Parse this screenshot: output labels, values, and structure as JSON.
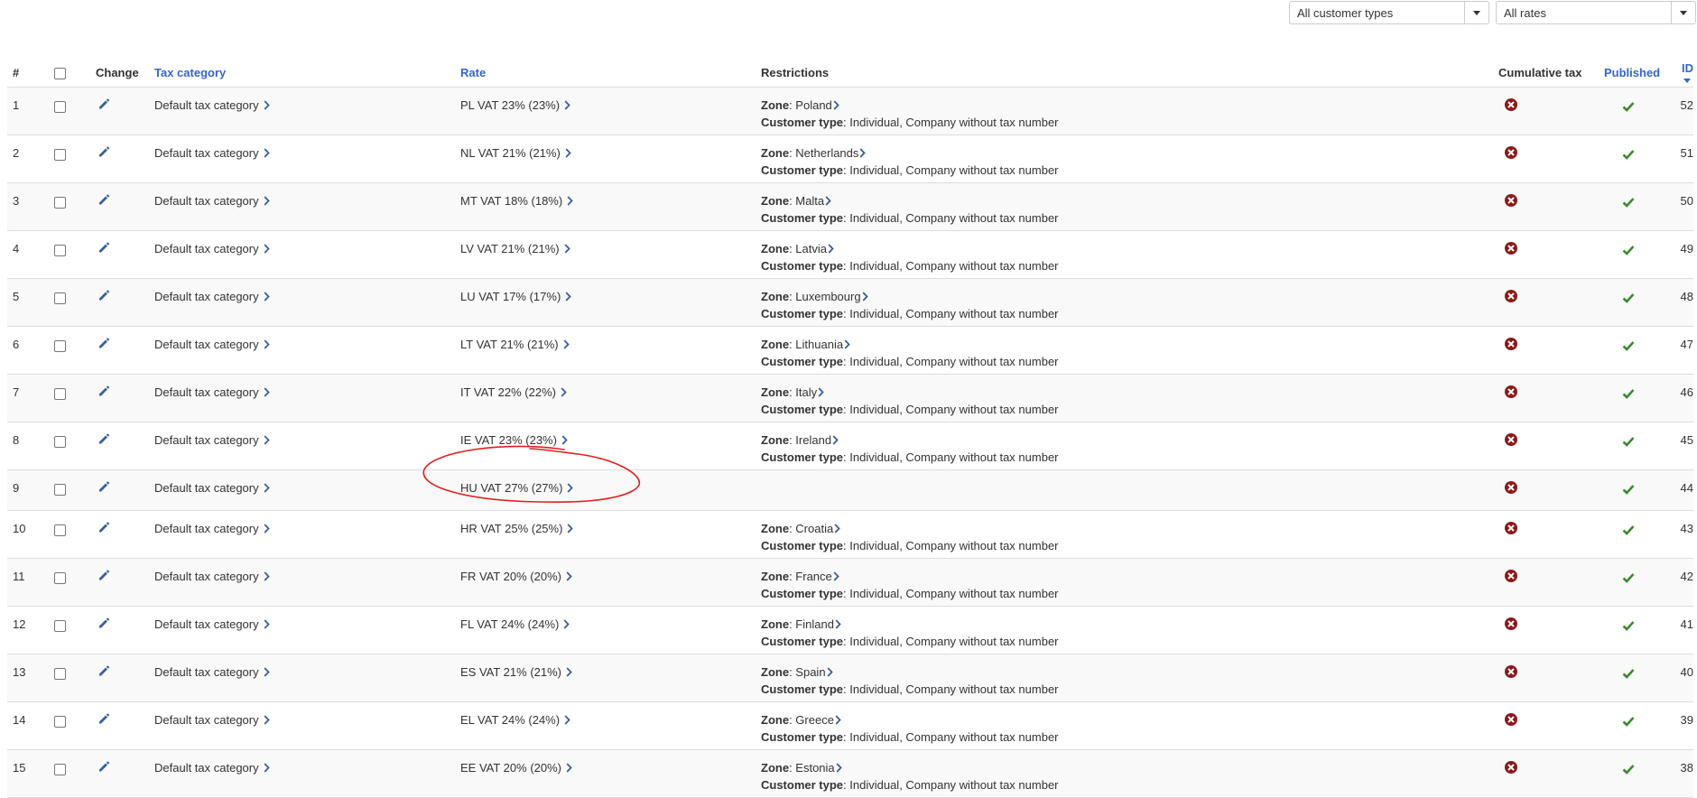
{
  "filters": {
    "customer_types": "All customer types",
    "rates": "All rates"
  },
  "columns": {
    "num": "#",
    "change": "Change",
    "tax_category": "Tax category",
    "rate": "Rate",
    "restrictions": "Restrictions",
    "cumulative": "Cumulative tax",
    "published": "Published",
    "id": "ID"
  },
  "restriction_labels": {
    "zone": "Zone",
    "customer_type": "Customer type"
  },
  "colors": {
    "link": "#3366cc",
    "cumulative_no": "#8b1a1a",
    "published_yes": "#3c8a2e",
    "annotation": "#e0201c"
  },
  "rows": [
    {
      "num": "1",
      "category": "Default tax category",
      "rate": "PL VAT 23% (23%)",
      "zone": "Poland",
      "customer_type": "Individual, Company without tax number",
      "id": "52"
    },
    {
      "num": "2",
      "category": "Default tax category",
      "rate": "NL VAT 21% (21%)",
      "zone": "Netherlands",
      "customer_type": "Individual, Company without tax number",
      "id": "51"
    },
    {
      "num": "3",
      "category": "Default tax category",
      "rate": "MT VAT 18% (18%)",
      "zone": "Malta",
      "customer_type": "Individual, Company without tax number",
      "id": "50"
    },
    {
      "num": "4",
      "category": "Default tax category",
      "rate": "LV VAT 21% (21%)",
      "zone": "Latvia",
      "customer_type": "Individual, Company without tax number",
      "id": "49"
    },
    {
      "num": "5",
      "category": "Default tax category",
      "rate": "LU VAT 17% (17%)",
      "zone": "Luxembourg",
      "customer_type": "Individual, Company without tax number",
      "id": "48"
    },
    {
      "num": "6",
      "category": "Default tax category",
      "rate": "LT VAT 21% (21%)",
      "zone": "Lithuania",
      "customer_type": "Individual, Company without tax number",
      "id": "47"
    },
    {
      "num": "7",
      "category": "Default tax category",
      "rate": "IT VAT 22% (22%)",
      "zone": "Italy",
      "customer_type": "Individual, Company without tax number",
      "id": "46"
    },
    {
      "num": "8",
      "category": "Default tax category",
      "rate": "IE VAT 23% (23%)",
      "zone": "Ireland",
      "customer_type": "Individual, Company without tax number",
      "id": "45"
    },
    {
      "num": "9",
      "category": "Default tax category",
      "rate": "HU VAT 27% (27%)",
      "zone": "",
      "customer_type": "",
      "id": "44"
    },
    {
      "num": "10",
      "category": "Default tax category",
      "rate": "HR VAT 25% (25%)",
      "zone": "Croatia",
      "customer_type": "Individual, Company without tax number",
      "id": "43"
    },
    {
      "num": "11",
      "category": "Default tax category",
      "rate": "FR VAT 20% (20%)",
      "zone": "France",
      "customer_type": "Individual, Company without tax number",
      "id": "42"
    },
    {
      "num": "12",
      "category": "Default tax category",
      "rate": "FL VAT 24% (24%)",
      "zone": "Finland",
      "customer_type": "Individual, Company without tax number",
      "id": "41"
    },
    {
      "num": "13",
      "category": "Default tax category",
      "rate": "ES VAT 21% (21%)",
      "zone": "Spain",
      "customer_type": "Individual, Company without tax number",
      "id": "40"
    },
    {
      "num": "14",
      "category": "Default tax category",
      "rate": "EL VAT 24% (24%)",
      "zone": "Greece",
      "customer_type": "Individual, Company without tax number",
      "id": "39"
    },
    {
      "num": "15",
      "category": "Default tax category",
      "rate": "EE VAT 20% (20%)",
      "zone": "Estonia",
      "customer_type": "Individual, Company without tax number",
      "id": "38"
    }
  ]
}
